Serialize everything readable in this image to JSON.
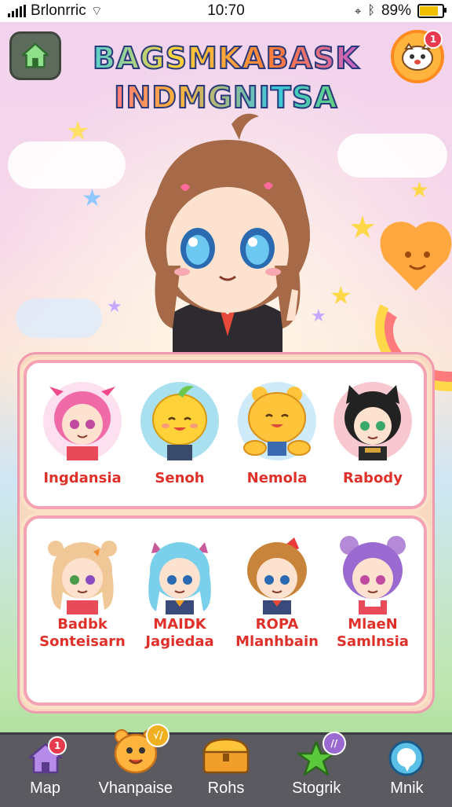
{
  "status_bar": {
    "carrier": "Brlonrric",
    "time": "10:70",
    "battery": "89%",
    "battery_level": 0.89
  },
  "header": {
    "title_line1": "BAGSMKABASK",
    "title_line2": "INDMGNITSA",
    "profile_badge": "1"
  },
  "roster_top": [
    {
      "name": "Ingdansia"
    },
    {
      "name": "Senoh"
    },
    {
      "name": "Nemola"
    },
    {
      "name": "Rabody"
    }
  ],
  "roster_bottom": [
    {
      "name": "Badbk",
      "subtitle": "Sonteisarn"
    },
    {
      "name": "MAIDK",
      "subtitle": "Jagiedaa"
    },
    {
      "name": "ROPA",
      "subtitle": "Mlanhbain"
    },
    {
      "name": "MlaeN",
      "subtitle": "Samlnsia"
    }
  ],
  "nav": {
    "items": [
      {
        "label": "Map",
        "badge": "1"
      },
      {
        "label": "Vhanpaise",
        "badge": "√/"
      },
      {
        "label": "Rohs"
      },
      {
        "label": "Stogrik",
        "badge": "//"
      },
      {
        "label": "Mnik"
      }
    ]
  },
  "colors": {
    "name_red": "#e0302a",
    "panel_border": "#f4a2b4",
    "nav_bg": "#5a5a60",
    "accent_orange": "#ffb53d"
  }
}
